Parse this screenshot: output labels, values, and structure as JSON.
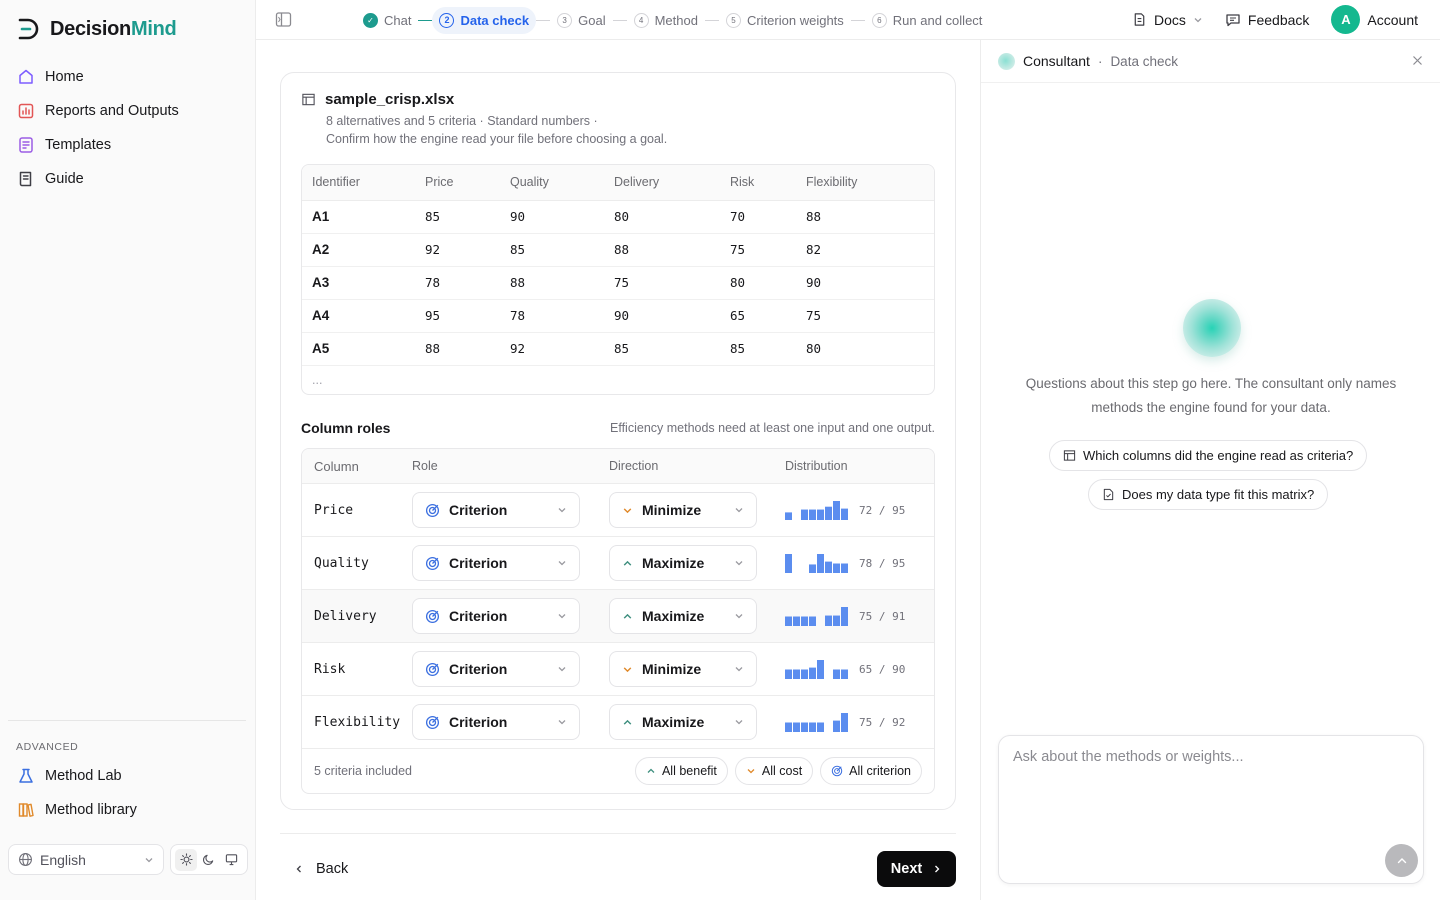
{
  "app": {
    "name_part1": "Decision",
    "name_part2": "Mind",
    "brand_color": "#1d9b8e"
  },
  "sidebar": {
    "items": [
      {
        "label": "Home",
        "icon": "home-icon"
      },
      {
        "label": "Reports and Outputs",
        "icon": "chart-icon"
      },
      {
        "label": "Templates",
        "icon": "template-icon"
      },
      {
        "label": "Guide",
        "icon": "book-icon"
      }
    ],
    "advanced_label": "ADVANCED",
    "advanced_items": [
      {
        "label": "Method Lab",
        "icon": "flask-icon"
      },
      {
        "label": "Method library",
        "icon": "library-icon"
      }
    ],
    "language": "English"
  },
  "topbar": {
    "steps": [
      {
        "num": "✓",
        "label": "Chat",
        "state": "done"
      },
      {
        "num": "2",
        "label": "Data check",
        "state": "active"
      },
      {
        "num": "3",
        "label": "Goal",
        "state": "todo"
      },
      {
        "num": "4",
        "label": "Method",
        "state": "todo"
      },
      {
        "num": "5",
        "label": "Criterion weights",
        "state": "todo"
      },
      {
        "num": "6",
        "label": "Run and collect",
        "state": "todo"
      }
    ],
    "docs": "Docs",
    "feedback": "Feedback",
    "avatar_letter": "A",
    "account": "Account"
  },
  "file": {
    "name": "sample_crisp.xlsx",
    "meta_line1": "8 alternatives and 5 criteria · Standard numbers ·",
    "meta_line2": "Confirm how the engine read your file before choosing a goal."
  },
  "preview": {
    "headers": [
      "Identifier",
      "Price",
      "Quality",
      "Delivery",
      "Risk",
      "Flexibility"
    ],
    "rows": [
      [
        "A1",
        "85",
        "90",
        "80",
        "70",
        "88"
      ],
      [
        "A2",
        "92",
        "85",
        "88",
        "75",
        "82"
      ],
      [
        "A3",
        "78",
        "88",
        "75",
        "80",
        "90"
      ],
      [
        "A4",
        "95",
        "78",
        "90",
        "65",
        "75"
      ],
      [
        "A5",
        "88",
        "92",
        "85",
        "85",
        "80"
      ]
    ],
    "more": "..."
  },
  "roles": {
    "title": "Column roles",
    "note": "Efficiency methods need at least one input and one output.",
    "headers": {
      "column": "Column",
      "role": "Role",
      "direction": "Direction",
      "distribution": "Distribution"
    },
    "rows": [
      {
        "column": "Price",
        "role": "Criterion",
        "direction": "Minimize",
        "dir": "down",
        "range": "72 / 95",
        "hist": [
          0.4,
          0,
          0.55,
          0.55,
          0.55,
          0.7,
          1,
          0.6
        ]
      },
      {
        "column": "Quality",
        "role": "Criterion",
        "direction": "Maximize",
        "dir": "up",
        "range": "78 / 95",
        "hist": [
          1,
          0,
          0,
          0.45,
          1,
          0.6,
          0.5,
          0.5
        ]
      },
      {
        "column": "Delivery",
        "role": "Criterion",
        "direction": "Maximize",
        "dir": "up",
        "range": "75 / 91",
        "hist": [
          0.5,
          0.5,
          0.5,
          0.5,
          0,
          0.55,
          0.55,
          1
        ]
      },
      {
        "column": "Risk",
        "role": "Criterion",
        "direction": "Minimize",
        "dir": "down",
        "range": "65 / 90",
        "hist": [
          0.5,
          0.5,
          0.5,
          0.6,
          1,
          0,
          0.5,
          0.5
        ]
      },
      {
        "column": "Flexibility",
        "role": "Criterion",
        "direction": "Maximize",
        "dir": "up",
        "range": "75 / 92",
        "hist": [
          0.5,
          0.5,
          0.5,
          0.5,
          0.5,
          0,
          0.6,
          1
        ]
      }
    ],
    "footer": "5 criteria included",
    "pills": [
      "All benefit",
      "All cost",
      "All criterion"
    ]
  },
  "nav": {
    "back": "Back",
    "next": "Next"
  },
  "consultant": {
    "title": "Consultant",
    "subtitle": "Data check",
    "intro": "Questions about this step go here. The consultant only names methods the engine found for your data.",
    "suggestions": [
      "Which columns did the engine read as criteria?",
      "Does my data type fit this matrix?"
    ],
    "placeholder": "Ask about the methods or weights..."
  },
  "colors": {
    "hist_bar": "#5b8def",
    "minimize_arrow": "#e0892a",
    "maximize_arrow": "#3f8f7f",
    "criterion_icon": "#3b6fe0"
  }
}
